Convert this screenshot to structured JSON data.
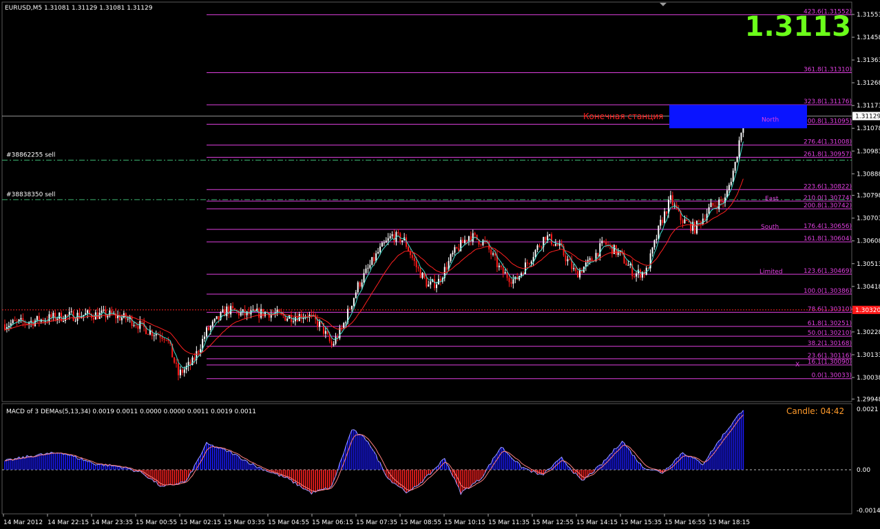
{
  "header": {
    "symbol_info": "EURUSD,M5  1.31081 1.31129 1.31081 1.31129"
  },
  "big_price": "1.3113",
  "orders": [
    {
      "label": "#38862255 sell",
      "price": 1.30945
    },
    {
      "label": "#38838350 sell",
      "price": 1.3078
    }
  ],
  "annotation": "Конечная станция",
  "zones": [
    {
      "label": "North",
      "price": 1.31095
    },
    {
      "label": "East",
      "price": 1.30774
    },
    {
      "label": "South",
      "price": 1.30656
    },
    {
      "label": "Limited",
      "price": 1.30469
    }
  ],
  "x_mark": "X",
  "candle_timer": "Candle:   04:42",
  "macd_title": "MACD of 3 DEMAs(5,13,34) 0.0019 0.0011 0.0000 0.0000 0.0011 0.0019 0.0011",
  "colors": {
    "bull": "#ffffff",
    "bear": "#ff1a1a",
    "fibo": "#e040e0",
    "ma_fast": "#40e0d0",
    "ma_slow": "#ff2020",
    "macd_pos": "#1a1aff",
    "macd_neg": "#ff2020",
    "order_line": "#3cb371",
    "ask_line": "#c0c0c0"
  },
  "chart_data": {
    "type": "candlestick",
    "symbol": "EURUSD",
    "timeframe": "M5",
    "price_ticks": [
      "1.31553",
      "1.31458",
      "1.31363",
      "1.31268",
      "1.31173",
      "1.31078",
      "1.30983",
      "1.30888",
      "1.30798",
      "1.30703",
      "1.30608",
      "1.30513",
      "1.30418",
      "1.30323",
      "1.30228",
      "1.30133",
      "1.30038",
      "1.29948"
    ],
    "current_price": "1.31129",
    "red_marker_price": "1.30320",
    "time_ticks": [
      "14 Mar 2012",
      "14 Mar 22:15",
      "14 Mar 23:35",
      "15 Mar 00:55",
      "15 Mar 02:15",
      "15 Mar 03:35",
      "15 Mar 04:55",
      "15 Mar 06:15",
      "15 Mar 07:35",
      "15 Mar 08:55",
      "15 Mar 10:15",
      "15 Mar 11:35",
      "15 Mar 12:55",
      "15 Mar 14:15",
      "15 Mar 15:35",
      "15 Mar 16:55",
      "15 Mar 18:15"
    ],
    "fibo_levels": [
      {
        "label": "423.6(1.31552)",
        "price": 1.31552
      },
      {
        "label": "361.8(1.31310)",
        "price": 1.3131
      },
      {
        "label": "323.8(1.31176)",
        "price": 1.31176
      },
      {
        "label": "300.8(1.31095)",
        "price": 1.31095
      },
      {
        "label": "276.4(1.31008)",
        "price": 1.31008
      },
      {
        "label": "261.8(1.30957)",
        "price": 1.30957
      },
      {
        "label": "223.6(1.30822)",
        "price": 1.30822
      },
      {
        "label": "210.0(1.30774)",
        "price": 1.30774
      },
      {
        "label": "200.8(1.30742)",
        "price": 1.30742
      },
      {
        "label": "176.4(1.30656)",
        "price": 1.30656
      },
      {
        "label": "161.8(1.30604)",
        "price": 1.30604
      },
      {
        "label": "123.6(1.30469)",
        "price": 1.30469
      },
      {
        "label": "100.0(1.30386)",
        "price": 1.30386
      },
      {
        "label": "78.6(1.30310)",
        "price": 1.3031
      },
      {
        "label": "61.8(1.30251)",
        "price": 1.30251
      },
      {
        "label": "50.0(1.30210)",
        "price": 1.3021
      },
      {
        "label": "38.2(1.30168)",
        "price": 1.30168
      },
      {
        "label": "23.6(1.30116)",
        "price": 1.30116
      },
      {
        "label": "16.1(1.30090)",
        "price": 1.3009
      },
      {
        "label": "0.0(1.30033)",
        "price": 1.30033
      }
    ],
    "waypoints": [
      [
        0,
        1.3026
      ],
      [
        12,
        1.3027
      ],
      [
        25,
        1.3029
      ],
      [
        40,
        1.303
      ],
      [
        52,
        1.303
      ],
      [
        62,
        1.3028
      ],
      [
        72,
        1.3023
      ],
      [
        80,
        1.3021
      ],
      [
        86,
        1.3005
      ],
      [
        93,
        1.301
      ],
      [
        100,
        1.3023
      ],
      [
        110,
        1.3032
      ],
      [
        120,
        1.303
      ],
      [
        130,
        1.3031
      ],
      [
        140,
        1.3029
      ],
      [
        150,
        1.303
      ],
      [
        157,
        1.3025
      ],
      [
        162,
        1.3017
      ],
      [
        167,
        1.3024
      ],
      [
        175,
        1.3042
      ],
      [
        185,
        1.3056
      ],
      [
        192,
        1.3063
      ],
      [
        198,
        1.3061
      ],
      [
        204,
        1.305
      ],
      [
        210,
        1.3042
      ],
      [
        215,
        1.3044
      ],
      [
        222,
        1.3055
      ],
      [
        230,
        1.3063
      ],
      [
        238,
        1.306
      ],
      [
        246,
        1.3048
      ],
      [
        253,
        1.3044
      ],
      [
        260,
        1.3053
      ],
      [
        268,
        1.3063
      ],
      [
        275,
        1.3058
      ],
      [
        283,
        1.3047
      ],
      [
        290,
        1.3052
      ],
      [
        297,
        1.306
      ],
      [
        305,
        1.3055
      ],
      [
        312,
        1.3047
      ],
      [
        318,
        1.3048
      ],
      [
        325,
        1.3068
      ],
      [
        330,
        1.3078
      ],
      [
        335,
        1.307
      ],
      [
        342,
        1.3066
      ],
      [
        350,
        1.3075
      ],
      [
        357,
        1.3078
      ],
      [
        362,
        1.3093
      ],
      [
        366,
        1.3112
      ]
    ],
    "macd_scale": {
      "max": 0.0021,
      "zero": 0.0,
      "min": -0.0014
    },
    "macd_ticks": [
      "0.0021",
      "0.00",
      "-0.0014"
    ],
    "macd_waypoints": [
      [
        0,
        0.0003
      ],
      [
        15,
        0.0005
      ],
      [
        28,
        0.0006
      ],
      [
        45,
        0.0002
      ],
      [
        58,
        0.0001
      ],
      [
        68,
        -0.0001
      ],
      [
        78,
        -0.0006
      ],
      [
        90,
        -0.0004
      ],
      [
        100,
        0.0009
      ],
      [
        112,
        0.0006
      ],
      [
        125,
        0.0001
      ],
      [
        140,
        -0.0003
      ],
      [
        152,
        -0.0008
      ],
      [
        162,
        -0.0006
      ],
      [
        172,
        0.0014
      ],
      [
        180,
        0.001
      ],
      [
        190,
        -0.0003
      ],
      [
        200,
        -0.0008
      ],
      [
        210,
        -0.0002
      ],
      [
        218,
        0.0004
      ],
      [
        226,
        -0.0008
      ],
      [
        236,
        -0.0003
      ],
      [
        246,
        0.0008
      ],
      [
        256,
        0.0001
      ],
      [
        266,
        -0.0002
      ],
      [
        276,
        0.0004
      ],
      [
        286,
        -0.0004
      ],
      [
        296,
        0.0002
      ],
      [
        306,
        0.001
      ],
      [
        316,
        0.0001
      ],
      [
        326,
        -0.0001
      ],
      [
        336,
        0.0006
      ],
      [
        346,
        0.0002
      ],
      [
        356,
        0.0012
      ],
      [
        366,
        0.0021
      ]
    ]
  }
}
